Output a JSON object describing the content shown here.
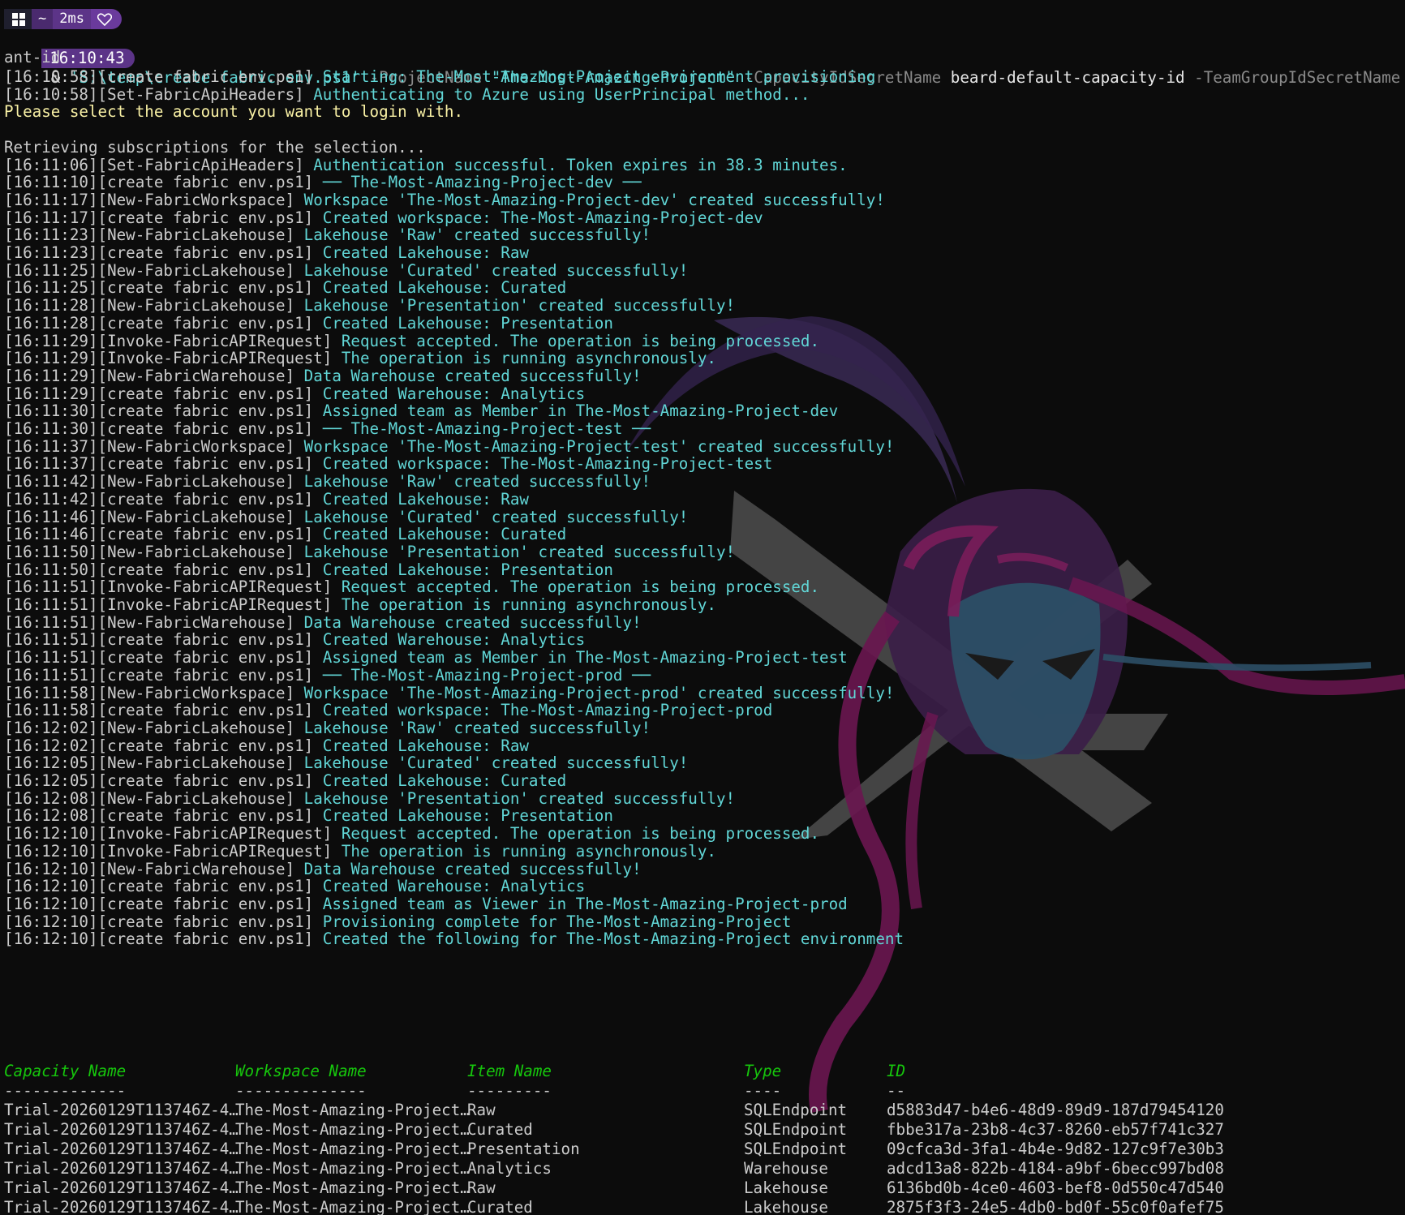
{
  "prompt": {
    "os_icon": "windows-icon",
    "home": "~",
    "duration": "2ms",
    "heart_icon": "heart-icon",
    "time": "16:10:43",
    "command": {
      "amp": "& ",
      "script": "'S:\\temp\\create fabric env.ps1'",
      "p1_name": " -ProjectName ",
      "p1_val": "\"The-Most-Amazing-Project\"",
      "p2_name": " -CapacityIdSecretName ",
      "p2_val": "beard-default-capacity-id",
      "p3_name": " -TeamGroupIdSecretName "
    },
    "wrap": "ant-id"
  },
  "log": [
    {
      "ts": "[16:10:58]",
      "src": "[create fabric env.ps1]",
      "msg": " Starting: The-Most-Amazing-Project environment provisioning"
    },
    {
      "ts": "[16:10:58]",
      "src": "[Set-FabricApiHeaders]",
      "msg": " Authenticating to Azure using UserPrincipal method..."
    },
    {
      "plain": "Please select the account you want to login with.",
      "kind": "warn"
    },
    {
      "plain": "",
      "kind": "plain"
    },
    {
      "plain": "Retrieving subscriptions for the selection...",
      "kind": "plain"
    },
    {
      "ts": "[16:11:06]",
      "src": "[Set-FabricApiHeaders]",
      "msg": " Authentication successful. Token expires in 38.3 minutes."
    },
    {
      "ts": "[16:11:10]",
      "src": "[create fabric env.ps1]",
      "msg": " ── The-Most-Amazing-Project-dev ──"
    },
    {
      "ts": "[16:11:17]",
      "src": "[New-FabricWorkspace]",
      "msg": " Workspace 'The-Most-Amazing-Project-dev' created successfully!"
    },
    {
      "ts": "[16:11:17]",
      "src": "[create fabric env.ps1]",
      "msg": " Created workspace: The-Most-Amazing-Project-dev"
    },
    {
      "ts": "[16:11:23]",
      "src": "[New-FabricLakehouse]",
      "msg": " Lakehouse 'Raw' created successfully!"
    },
    {
      "ts": "[16:11:23]",
      "src": "[create fabric env.ps1]",
      "msg": " Created Lakehouse: Raw"
    },
    {
      "ts": "[16:11:25]",
      "src": "[New-FabricLakehouse]",
      "msg": " Lakehouse 'Curated' created successfully!"
    },
    {
      "ts": "[16:11:25]",
      "src": "[create fabric env.ps1]",
      "msg": " Created Lakehouse: Curated"
    },
    {
      "ts": "[16:11:28]",
      "src": "[New-FabricLakehouse]",
      "msg": " Lakehouse 'Presentation' created successfully!"
    },
    {
      "ts": "[16:11:28]",
      "src": "[create fabric env.ps1]",
      "msg": " Created Lakehouse: Presentation"
    },
    {
      "ts": "[16:11:29]",
      "src": "[Invoke-FabricAPIRequest]",
      "msg": " Request accepted. The operation is being processed."
    },
    {
      "ts": "[16:11:29]",
      "src": "[Invoke-FabricAPIRequest]",
      "msg": " The operation is running asynchronously."
    },
    {
      "ts": "[16:11:29]",
      "src": "[New-FabricWarehouse]",
      "msg": " Data Warehouse created successfully!"
    },
    {
      "ts": "[16:11:29]",
      "src": "[create fabric env.ps1]",
      "msg": " Created Warehouse: Analytics"
    },
    {
      "ts": "[16:11:30]",
      "src": "[create fabric env.ps1]",
      "msg": " Assigned team as Member in The-Most-Amazing-Project-dev"
    },
    {
      "ts": "[16:11:30]",
      "src": "[create fabric env.ps1]",
      "msg": " ── The-Most-Amazing-Project-test ──"
    },
    {
      "ts": "[16:11:37]",
      "src": "[New-FabricWorkspace]",
      "msg": " Workspace 'The-Most-Amazing-Project-test' created successfully!"
    },
    {
      "ts": "[16:11:37]",
      "src": "[create fabric env.ps1]",
      "msg": " Created workspace: The-Most-Amazing-Project-test"
    },
    {
      "ts": "[16:11:42]",
      "src": "[New-FabricLakehouse]",
      "msg": " Lakehouse 'Raw' created successfully!"
    },
    {
      "ts": "[16:11:42]",
      "src": "[create fabric env.ps1]",
      "msg": " Created Lakehouse: Raw"
    },
    {
      "ts": "[16:11:46]",
      "src": "[New-FabricLakehouse]",
      "msg": " Lakehouse 'Curated' created successfully!"
    },
    {
      "ts": "[16:11:46]",
      "src": "[create fabric env.ps1]",
      "msg": " Created Lakehouse: Curated"
    },
    {
      "ts": "[16:11:50]",
      "src": "[New-FabricLakehouse]",
      "msg": " Lakehouse 'Presentation' created successfully!"
    },
    {
      "ts": "[16:11:50]",
      "src": "[create fabric env.ps1]",
      "msg": " Created Lakehouse: Presentation"
    },
    {
      "ts": "[16:11:51]",
      "src": "[Invoke-FabricAPIRequest]",
      "msg": " Request accepted. The operation is being processed."
    },
    {
      "ts": "[16:11:51]",
      "src": "[Invoke-FabricAPIRequest]",
      "msg": " The operation is running asynchronously."
    },
    {
      "ts": "[16:11:51]",
      "src": "[New-FabricWarehouse]",
      "msg": " Data Warehouse created successfully!"
    },
    {
      "ts": "[16:11:51]",
      "src": "[create fabric env.ps1]",
      "msg": " Created Warehouse: Analytics"
    },
    {
      "ts": "[16:11:51]",
      "src": "[create fabric env.ps1]",
      "msg": " Assigned team as Member in The-Most-Amazing-Project-test"
    },
    {
      "ts": "[16:11:51]",
      "src": "[create fabric env.ps1]",
      "msg": " ── The-Most-Amazing-Project-prod ──"
    },
    {
      "ts": "[16:11:58]",
      "src": "[New-FabricWorkspace]",
      "msg": " Workspace 'The-Most-Amazing-Project-prod' created successfully!"
    },
    {
      "ts": "[16:11:58]",
      "src": "[create fabric env.ps1]",
      "msg": " Created workspace: The-Most-Amazing-Project-prod"
    },
    {
      "ts": "[16:12:02]",
      "src": "[New-FabricLakehouse]",
      "msg": " Lakehouse 'Raw' created successfully!"
    },
    {
      "ts": "[16:12:02]",
      "src": "[create fabric env.ps1]",
      "msg": " Created Lakehouse: Raw"
    },
    {
      "ts": "[16:12:05]",
      "src": "[New-FabricLakehouse]",
      "msg": " Lakehouse 'Curated' created successfully!"
    },
    {
      "ts": "[16:12:05]",
      "src": "[create fabric env.ps1]",
      "msg": " Created Lakehouse: Curated"
    },
    {
      "ts": "[16:12:08]",
      "src": "[New-FabricLakehouse]",
      "msg": " Lakehouse 'Presentation' created successfully!"
    },
    {
      "ts": "[16:12:08]",
      "src": "[create fabric env.ps1]",
      "msg": " Created Lakehouse: Presentation"
    },
    {
      "ts": "[16:12:10]",
      "src": "[Invoke-FabricAPIRequest]",
      "msg": " Request accepted. The operation is being processed."
    },
    {
      "ts": "[16:12:10]",
      "src": "[Invoke-FabricAPIRequest]",
      "msg": " The operation is running asynchronously."
    },
    {
      "ts": "[16:12:10]",
      "src": "[New-FabricWarehouse]",
      "msg": " Data Warehouse created successfully!"
    },
    {
      "ts": "[16:12:10]",
      "src": "[create fabric env.ps1]",
      "msg": " Created Warehouse: Analytics"
    },
    {
      "ts": "[16:12:10]",
      "src": "[create fabric env.ps1]",
      "msg": " Assigned team as Viewer in The-Most-Amazing-Project-prod"
    },
    {
      "ts": "[16:12:10]",
      "src": "[create fabric env.ps1]",
      "msg": " Provisioning complete for The-Most-Amazing-Project"
    },
    {
      "ts": "[16:12:10]",
      "src": "[create fabric env.ps1]",
      "msg": " Created the following for The-Most-Amazing-Project environment"
    }
  ],
  "table": {
    "headers": [
      "Capacity Name",
      "Workspace Name",
      "Item Name",
      "Type",
      "ID"
    ],
    "dashes": [
      "-------------",
      "--------------",
      "---------",
      "----",
      "--"
    ],
    "rows": [
      [
        "Trial-20260129T113746Z-4…",
        "The-Most-Amazing-Project…",
        "Raw",
        "SQLEndpoint",
        "d5883d47-b4e6-48d9-89d9-187d79454120"
      ],
      [
        "Trial-20260129T113746Z-4…",
        "The-Most-Amazing-Project…",
        "Curated",
        "SQLEndpoint",
        "fbbe317a-23b8-4c37-8260-eb57f741c327"
      ],
      [
        "Trial-20260129T113746Z-4…",
        "The-Most-Amazing-Project…",
        "Presentation",
        "SQLEndpoint",
        "09cfca3d-3fa1-4b4e-9d82-127c9f7e30b3"
      ],
      [
        "Trial-20260129T113746Z-4…",
        "The-Most-Amazing-Project…",
        "Analytics",
        "Warehouse",
        "adcd13a8-822b-4184-a9bf-6becc997bd08"
      ],
      [
        "Trial-20260129T113746Z-4…",
        "The-Most-Amazing-Project…",
        "Raw",
        "Lakehouse",
        "6136bd0b-4ce0-4603-bef8-0d550c47d540"
      ],
      [
        "Trial-20260129T113746Z-4…",
        "The-Most-Amazing-Project…",
        "Curated",
        "Lakehouse",
        "2875f3f3-24e5-4db0-bd0f-55c0f0afef75"
      ]
    ]
  },
  "colors": {
    "background": "#0c0c0c",
    "log_message": "#61d6d6",
    "warning": "#f9f1a5",
    "table_header": "#16c60c",
    "prompt_segment": "#5c3488"
  },
  "watermark": "background-logo-image"
}
